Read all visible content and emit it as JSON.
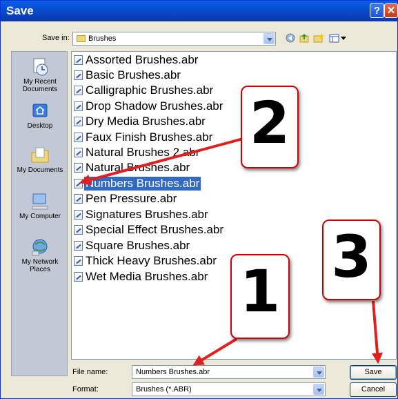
{
  "window": {
    "title": "Save",
    "help_label": "?",
    "close_label": "✕"
  },
  "save_in": {
    "label": "Save in:",
    "value": "Brushes"
  },
  "places": [
    {
      "label": "My Recent Documents",
      "icon": "recent-documents-icon"
    },
    {
      "label": "Desktop",
      "icon": "desktop-icon"
    },
    {
      "label": "My Documents",
      "icon": "my-documents-icon"
    },
    {
      "label": "My Computer",
      "icon": "my-computer-icon"
    },
    {
      "label": "My Network Places",
      "icon": "network-places-icon"
    }
  ],
  "files": [
    "Assorted Brushes.abr",
    "Basic Brushes.abr",
    "Calligraphic Brushes.abr",
    "Drop Shadow Brushes.abr",
    "Dry Media Brushes.abr",
    "Faux Finish Brushes.abr",
    "Natural Brushes 2.abr",
    "Natural Brushes.abr",
    "Numbers Brushes.abr",
    "Pen Pressure.abr",
    "Signatures Brushes.abr",
    "Special Effect Brushes.abr",
    "Square Brushes.abr",
    "Thick Heavy Brushes.abr",
    "Wet Media Brushes.abr"
  ],
  "selected_file": "Numbers Brushes.abr",
  "file_name": {
    "label": "File name:",
    "value": "Numbers Brushes.abr"
  },
  "format": {
    "label": "Format:",
    "value": "Brushes (*.ABR)"
  },
  "buttons": {
    "save": "Save",
    "cancel": "Cancel"
  },
  "callouts": {
    "one": "1",
    "two": "2",
    "three": "3"
  },
  "colors": {
    "title_bar": "#0a5fe8",
    "selection": "#316ac5",
    "callout_border": "#cc0000",
    "arrow": "#e02020"
  }
}
